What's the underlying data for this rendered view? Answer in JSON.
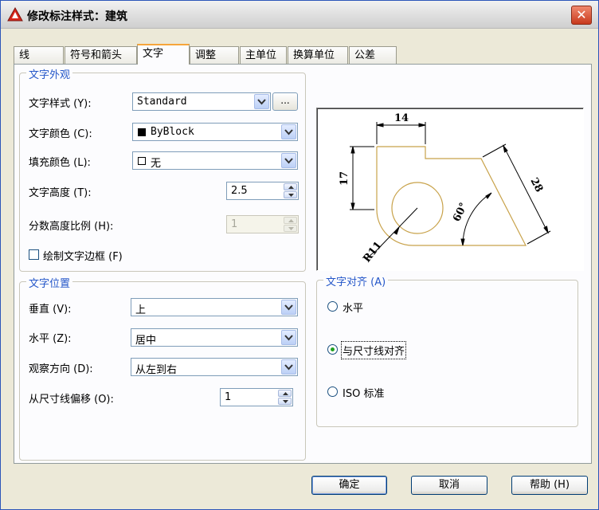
{
  "window": {
    "title": "修改标注样式：建筑",
    "close_glyph": "✕"
  },
  "tabs": [
    "线",
    "符号和箭头",
    "文字",
    "调整",
    "主单位",
    "换算单位",
    "公差"
  ],
  "text_appearance": {
    "legend": "文字外观",
    "style_label": "文字样式 (Y):",
    "style_value": "Standard",
    "ellipsis": "...",
    "color_label": "文字颜色 (C):",
    "color_value": "ByBlock",
    "fill_label": "填充颜色 (L):",
    "fill_value": "无",
    "height_label": "文字高度 (T):",
    "height_value": "2.5",
    "fraction_label": "分数高度比例 (H):",
    "fraction_value": "1",
    "frame_label": "绘制文字边框 (F)"
  },
  "text_placement": {
    "legend": "文字位置",
    "vertical_label": "垂直 (V):",
    "vertical_value": "上",
    "horizontal_label": "水平 (Z):",
    "horizontal_value": "居中",
    "view_label": "观察方向 (D):",
    "view_value": "从左到右",
    "offset_label": "从尺寸线偏移 (O):",
    "offset_value": "1"
  },
  "text_alignment": {
    "legend": "文字对齐 (A)",
    "options": [
      "水平",
      "与尺寸线对齐",
      "ISO 标准"
    ],
    "selected": "与尺寸线对齐"
  },
  "preview": {
    "dim_top": "14",
    "dim_left": "17",
    "dim_slant": "28",
    "dim_angle": "60°",
    "dim_radius": "R11"
  },
  "buttons": {
    "ok": "确定",
    "cancel": "取消",
    "help": "帮助 (H)"
  },
  "colors": {
    "legend": "#2557c9",
    "geometry": "#c8a24a",
    "accent_tab": "#f6a53a",
    "radio_dot": "#21a121"
  }
}
